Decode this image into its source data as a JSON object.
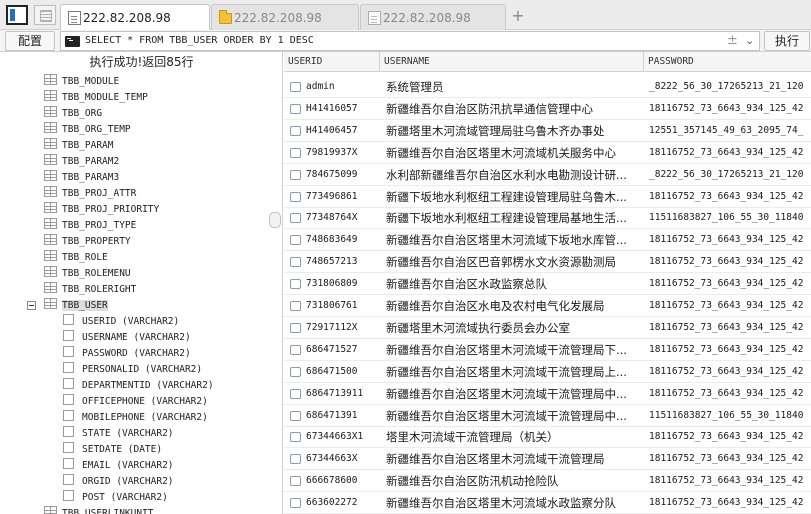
{
  "tabs": [
    {
      "label": "222.82.208.98",
      "active": true,
      "icon": "document-icon"
    },
    {
      "label": "222.82.208.98",
      "active": false,
      "icon": "folder-icon"
    },
    {
      "label": "222.82.208.98",
      "active": false,
      "icon": "document-icon"
    }
  ],
  "toolbar": {
    "config_label": "配置",
    "sql": "SELECT * FROM TBB_USER ORDER BY 1 DESC",
    "plusminus": "±",
    "chevron": "⌄",
    "run_label": "执行",
    "new_tab": "+"
  },
  "status": "执行成功!返回85行",
  "tree": {
    "tables": [
      "TBB_MODULE",
      "TBB_MODULE_TEMP",
      "TBB_ORG",
      "TBB_ORG_TEMP",
      "TBB_PARAM",
      "TBB_PARAM2",
      "TBB_PARAM3",
      "TBB_PROJ_ATTR",
      "TBB_PROJ_PRIORITY",
      "TBB_PROJ_TYPE",
      "TBB_PROPERTY",
      "TBB_ROLE",
      "TBB_ROLEMENU",
      "TBB_ROLERIGHT"
    ],
    "expanded_table": "TBB_USER",
    "columns": [
      "USERID (VARCHAR2)",
      "USERNAME (VARCHAR2)",
      "PASSWORD (VARCHAR2)",
      "PERSONALID (VARCHAR2)",
      "DEPARTMENTID (VARCHAR2)",
      "OFFICEPHONE (VARCHAR2)",
      "MOBILEPHONE (VARCHAR2)",
      "STATE (VARCHAR2)",
      "SETDATE (DATE)",
      "EMAIL (VARCHAR2)",
      "ORGID (VARCHAR2)",
      "POST (VARCHAR2)"
    ],
    "partial_next": "TBB_USERLINKUNIT"
  },
  "grid": {
    "headers": {
      "id": "USERID",
      "name": "USERNAME",
      "pw": "PASSWORD"
    },
    "rows": [
      {
        "id": "admin",
        "name": "系统管理员",
        "pw": "_8222_56_30_17265213_21_120"
      },
      {
        "id": "H41416057",
        "name": "新疆维吾尔自治区防汛抗旱通信管理中心",
        "pw": "18116752_73_6643_934_125_42"
      },
      {
        "id": "H41406457",
        "name": "新疆塔里木河流域管理局驻乌鲁木齐办事处",
        "pw": "12551_357145_49_63_2095_74_"
      },
      {
        "id": "79819937X",
        "name": "新疆维吾尔自治区塔里木河流域机关服务中心",
        "pw": "18116752_73_6643_934_125_42"
      },
      {
        "id": "784675099",
        "name": "水利部新疆维吾尔自治区水利水电勘测设计研...",
        "pw": "_8222_56_30_17265213_21_120"
      },
      {
        "id": "773496861",
        "name": "新疆下坂地水利枢纽工程建设管理局驻乌鲁木...",
        "pw": "18116752_73_6643_934_125_42"
      },
      {
        "id": "77348764X",
        "name": "新疆下坂地水利枢纽工程建设管理局基地生活...",
        "pw": "11511683827_106_55_30_11840"
      },
      {
        "id": "748683649",
        "name": "新疆维吾尔自治区塔里木河流域下坂地水库管...",
        "pw": "18116752_73_6643_934_125_42"
      },
      {
        "id": "748657213",
        "name": "新疆维吾尔自治区巴音郭楞水文水资源勘测局",
        "pw": "18116752_73_6643_934_125_42"
      },
      {
        "id": "731806809",
        "name": "新疆维吾尔自治区水政监察总队",
        "pw": "18116752_73_6643_934_125_42"
      },
      {
        "id": "731806761",
        "name": "新疆维吾尔自治区水电及农村电气化发展局",
        "pw": "18116752_73_6643_934_125_42"
      },
      {
        "id": "72917112X",
        "name": "新疆塔里木河流域执行委员会办公室",
        "pw": "18116752_73_6643_934_125_42"
      },
      {
        "id": "686471527",
        "name": "新疆维吾尔自治区塔里木河流域干流管理局下...",
        "pw": "18116752_73_6643_934_125_42"
      },
      {
        "id": "686471500",
        "name": "新疆维吾尔自治区塔里木河流域干流管理局上...",
        "pw": "18116752_73_6643_934_125_42"
      },
      {
        "id": "6864713911",
        "name": "新疆维吾尔自治区塔里木河流域干流管理局中...",
        "pw": "18116752_73_6643_934_125_42"
      },
      {
        "id": "686471391",
        "name": "新疆维吾尔自治区塔里木河流域干流管理局中...",
        "pw": "11511683827_106_55_30_11840"
      },
      {
        "id": "67344663X1",
        "name": "塔里木河流域干流管理局（机关）",
        "pw": "18116752_73_6643_934_125_42"
      },
      {
        "id": "67344663X",
        "name": "新疆维吾尔自治区塔里木河流域干流管理局",
        "pw": "18116752_73_6643_934_125_42"
      },
      {
        "id": "666678600",
        "name": "新疆维吾尔自治区防汛机动抢险队",
        "pw": "18116752_73_6643_934_125_42"
      },
      {
        "id": "663602272",
        "name": "新疆维吾尔自治区塔里木河流域水政监察分队",
        "pw": "18116752_73_6643_934_125_42"
      }
    ]
  }
}
